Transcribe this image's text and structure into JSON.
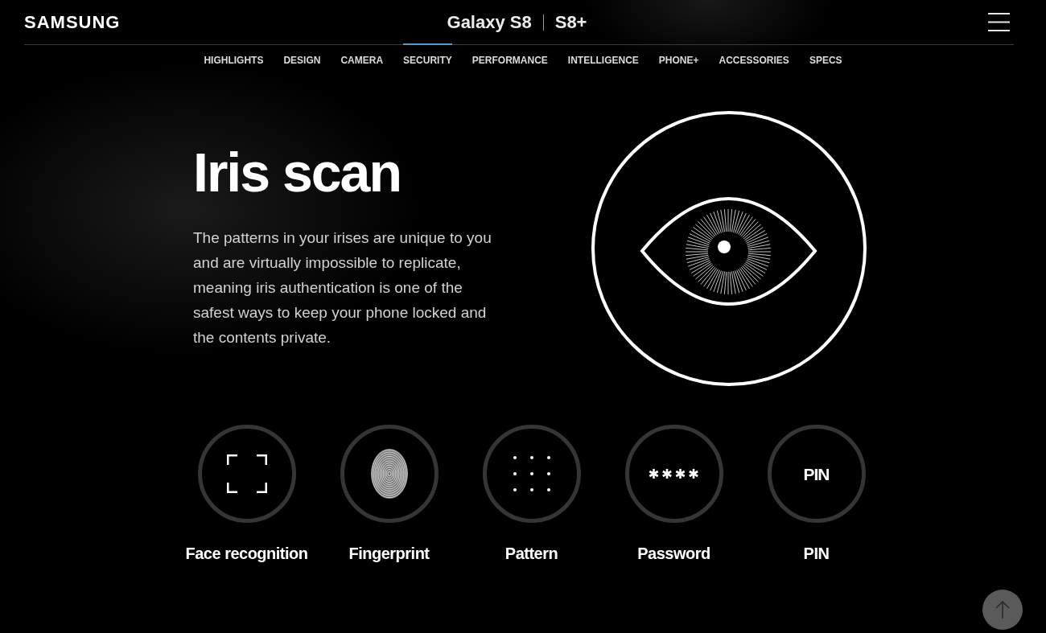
{
  "header": {
    "logo": "SAMSUNG",
    "title": "Galaxy S8",
    "title_variant": "S8+"
  },
  "nav": [
    {
      "label": "HIGHLIGHTS",
      "selected": false
    },
    {
      "label": "DESIGN",
      "selected": false
    },
    {
      "label": "CAMERA",
      "selected": false
    },
    {
      "label": "SECURITY",
      "selected": true
    },
    {
      "label": "PERFORMANCE",
      "selected": false
    },
    {
      "label": "INTELLIGENCE",
      "selected": false
    },
    {
      "label": "PHONE+",
      "selected": false
    },
    {
      "label": "ACCESSORIES",
      "selected": false
    },
    {
      "label": "SPECS",
      "selected": false
    }
  ],
  "hero": {
    "heading": "Iris scan",
    "body": "The patterns in your irises are unique to you and are virtually impossible to replicate, meaning iris authentication is one of the safest ways to keep your phone locked and the contents private."
  },
  "methods": [
    {
      "kind": "face",
      "label": "Face recognition"
    },
    {
      "kind": "fingerprint",
      "label": "Fingerprint"
    },
    {
      "kind": "pattern",
      "label": "Pattern"
    },
    {
      "kind": "password",
      "label": "Password"
    },
    {
      "kind": "pin",
      "label": "PIN",
      "icon_text": "PIN"
    }
  ]
}
